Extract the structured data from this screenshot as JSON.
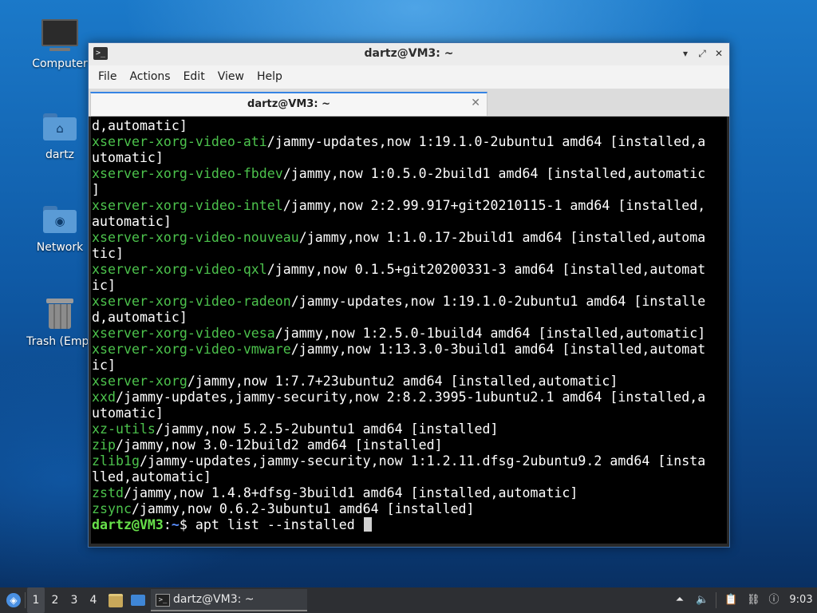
{
  "desktop": {
    "icons": [
      {
        "label": "Computer",
        "icon": "computer-icon"
      },
      {
        "label": "dartz",
        "icon": "home-folder-icon"
      },
      {
        "label": "Network",
        "icon": "network-folder-icon"
      },
      {
        "label": "Trash (Empt",
        "icon": "trash-icon"
      }
    ]
  },
  "window": {
    "title": "dartz@VM3: ~",
    "menu": [
      "File",
      "Actions",
      "Edit",
      "View",
      "Help"
    ],
    "tab_title": "dartz@VM3: ~",
    "controls": {
      "minimize": "▾",
      "maximize": "⤢",
      "close": "✕"
    }
  },
  "terminal": {
    "colors": {
      "background": "#000000",
      "text": "#ffffff",
      "package": "#4cc24c",
      "prompt_user": "#67e04a",
      "prompt_dir": "#5a8fff"
    },
    "lines": [
      {
        "text": "d,automatic]"
      },
      {
        "pkg": "xserver-xorg-video-ati",
        "text": "/jammy-updates,now 1:19.1.0-2ubuntu1 amd64 [installed,a"
      },
      {
        "text": "utomatic]"
      },
      {
        "pkg": "xserver-xorg-video-fbdev",
        "text": "/jammy,now 1:0.5.0-2build1 amd64 [installed,automatic"
      },
      {
        "text": "]"
      },
      {
        "pkg": "xserver-xorg-video-intel",
        "text": "/jammy,now 2:2.99.917+git20210115-1 amd64 [installed,"
      },
      {
        "text": "automatic]"
      },
      {
        "pkg": "xserver-xorg-video-nouveau",
        "text": "/jammy,now 1:1.0.17-2build1 amd64 [installed,automa"
      },
      {
        "text": "tic]"
      },
      {
        "pkg": "xserver-xorg-video-qxl",
        "text": "/jammy,now 0.1.5+git20200331-3 amd64 [installed,automat"
      },
      {
        "text": "ic]"
      },
      {
        "pkg": "xserver-xorg-video-radeon",
        "text": "/jammy-updates,now 1:19.1.0-2ubuntu1 amd64 [installe"
      },
      {
        "text": "d,automatic]"
      },
      {
        "pkg": "xserver-xorg-video-vesa",
        "text": "/jammy,now 1:2.5.0-1build4 amd64 [installed,automatic]"
      },
      {
        "pkg": "xserver-xorg-video-vmware",
        "text": "/jammy,now 1:13.3.0-3build1 amd64 [installed,automat"
      },
      {
        "text": "ic]"
      },
      {
        "pkg": "xserver-xorg",
        "text": "/jammy,now 1:7.7+23ubuntu2 amd64 [installed,automatic]"
      },
      {
        "pkg": "xxd",
        "text": "/jammy-updates,jammy-security,now 2:8.2.3995-1ubuntu2.1 amd64 [installed,a"
      },
      {
        "text": "utomatic]"
      },
      {
        "pkg": "xz-utils",
        "text": "/jammy,now 5.2.5-2ubuntu1 amd64 [installed]"
      },
      {
        "pkg": "zip",
        "text": "/jammy,now 3.0-12build2 amd64 [installed]"
      },
      {
        "pkg": "zlib1g",
        "text": "/jammy-updates,jammy-security,now 1:1.2.11.dfsg-2ubuntu9.2 amd64 [insta"
      },
      {
        "text": "lled,automatic]"
      },
      {
        "pkg": "zstd",
        "text": "/jammy,now 1.4.8+dfsg-3build1 amd64 [installed,automatic]"
      },
      {
        "pkg": "zsync",
        "text": "/jammy,now 0.6.2-3ubuntu1 amd64 [installed]"
      }
    ],
    "prompt": {
      "user_host": "dartz@VM3",
      "sep": ":",
      "dir": "~",
      "symbol": "$",
      "command": " apt list --installed "
    }
  },
  "taskbar": {
    "workspaces": [
      "1",
      "2",
      "3",
      "4"
    ],
    "active_workspace": "1",
    "task_label": "dartz@VM3: ~",
    "clock": "9:03",
    "icons": [
      "start-menu-icon",
      "file-manager-icon",
      "show-desktop-icon",
      "terminal-icon",
      "tray-arrow-icon",
      "volume-icon",
      "clipboard-icon",
      "network-icon",
      "update-notifier-icon"
    ]
  }
}
